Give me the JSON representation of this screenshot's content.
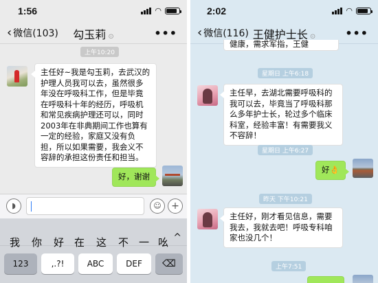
{
  "left_chat": {
    "status": {
      "time": "1:56",
      "battery_level": 0.85
    },
    "nav": {
      "back_label": "微信(103)",
      "title": "勾玉莉"
    },
    "timestamp": "上午10:20",
    "messages": [
      {
        "side": "left",
        "text": "主任好~我是勾玉莉，去武汉的护理人员我可以去，虽然很多年没在呼吸科工作，但是毕竟在呼吸科十年的经历，呼吸机和常见疾病护理还可以，同时2003年在非典期间工作也算有一定的经验，家庭又没有负担，所以如果需要，我会义不容辞的承担这份责任和担当。"
      },
      {
        "side": "right",
        "text": "好，谢谢"
      }
    ],
    "input": {
      "value": ""
    },
    "keyboard": {
      "candidates": [
        "我",
        "你",
        "好",
        "在",
        "这",
        "不",
        "一",
        "吆"
      ],
      "expand_glyph": "^",
      "keys": [
        "123",
        ",.?!",
        "ABC",
        "DEF",
        "⌫"
      ]
    }
  },
  "right_chat": {
    "status": {
      "time": "2:02",
      "battery_level": 0.85
    },
    "nav": {
      "back_label": "微信(116)",
      "title": "王健护士长"
    },
    "partial_top": "健康，需求军指，王健",
    "messages": [
      {
        "timestamp": "星期日 上午6:18",
        "side": "left",
        "text": "主任早，去湖北需要呼吸科的我可以去，毕竟当了呼吸科那么多年护士长，轮过多个临床科室，经验丰富！有需要我义不容辞！"
      },
      {
        "timestamp": "星期日 上午6:27",
        "side": "right",
        "text": "好👌"
      },
      {
        "timestamp": "昨天 下午10:21",
        "side": "left",
        "text": "主任好，刚才看见信息，需要我去，我就去吧！呼吸专科咱家也没几个！"
      },
      {
        "timestamp": "上午7:51",
        "side": "right",
        "text": ""
      }
    ]
  }
}
